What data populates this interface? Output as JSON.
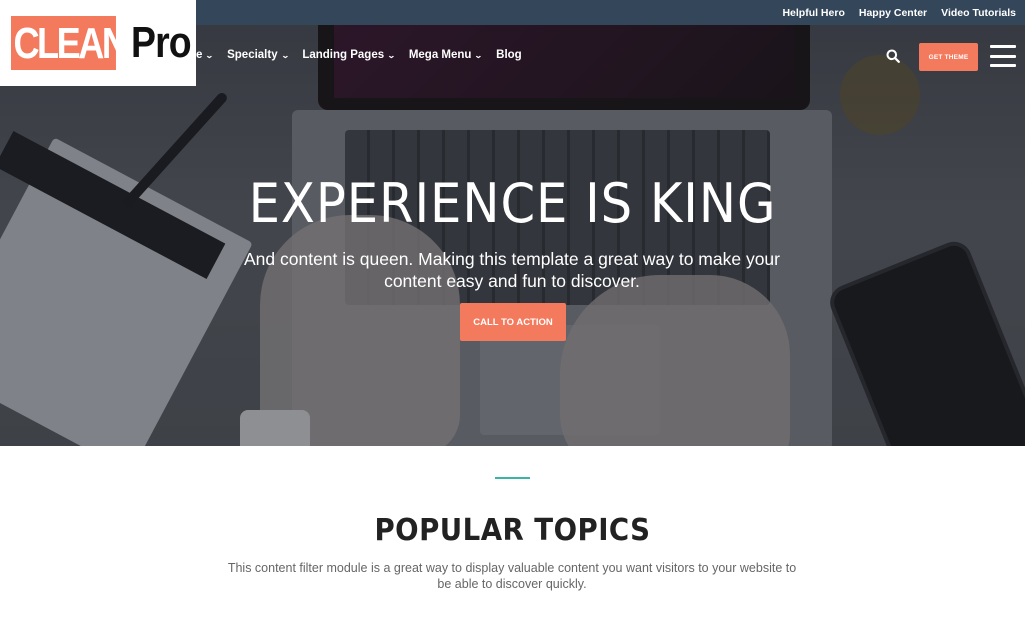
{
  "topbar": {
    "links": [
      "Helpful Hero",
      "Happy Center",
      "Video Tutorials"
    ]
  },
  "logo": {
    "part1": "CLEAN",
    "part2": "Pro"
  },
  "nav": {
    "items": [
      {
        "label": "e",
        "has_dropdown": true
      },
      {
        "label": "Specialty",
        "has_dropdown": true
      },
      {
        "label": "Landing Pages",
        "has_dropdown": true
      },
      {
        "label": "Mega Menu",
        "has_dropdown": true
      },
      {
        "label": "Blog",
        "has_dropdown": false
      }
    ],
    "get_theme_label": "GET THEME"
  },
  "hero": {
    "title": "EXPERIENCE IS KING",
    "subtitle": "And content is queen. Making this template a great way to make your content easy and fun to discover.",
    "cta_label": "CALL TO ACTION"
  },
  "section": {
    "title": "POPULAR TOPICS",
    "text": "This content filter module is a great way to display valuable content you want visitors to your website to be able to discover quickly."
  },
  "colors": {
    "accent": "#f47a5e",
    "topbar": "#33465a",
    "divider": "#3bb3a6"
  },
  "icons": {
    "chevron": "chevron-down-icon",
    "search": "search-icon",
    "menu": "hamburger-menu-icon"
  }
}
